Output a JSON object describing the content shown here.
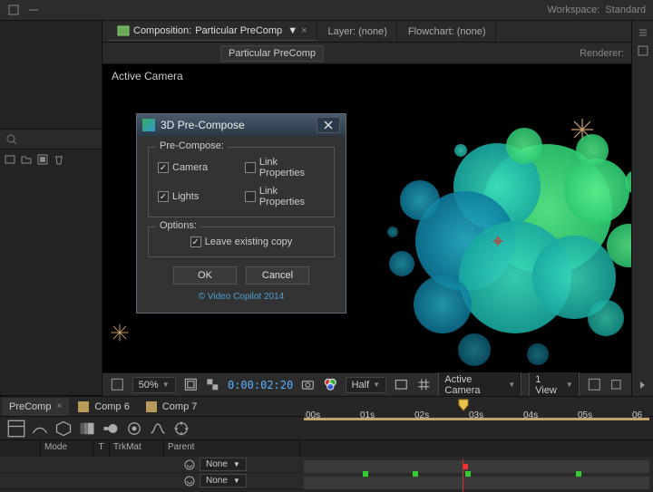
{
  "workspace": {
    "label": "Workspace:",
    "value": "Standard"
  },
  "comp_header": {
    "composition_label": "Composition:",
    "composition_name": "Particular PreComp",
    "layer_tab": "Layer: (none)",
    "flowchart_tab": "Flowchart: (none)",
    "subtab": "Particular PreComp",
    "renderer_label": "Renderer:"
  },
  "viewer": {
    "camera_label": "Active Camera"
  },
  "viewer_bar": {
    "zoom": "50%",
    "timecode": "0:00:02:20",
    "resolution": "Half",
    "camera_dd": "Active Camera",
    "views_dd": "1 View",
    "icons": {
      "bounds": "region-icon",
      "grid": "grid-icon",
      "snapshot": "snapshot-icon",
      "channels": "channels-icon",
      "transparency": "transparency-checker-icon"
    }
  },
  "timeline": {
    "tabs": [
      {
        "label": "PreComp",
        "active": true,
        "close": "×"
      },
      {
        "label": "Comp 6",
        "active": false
      },
      {
        "label": "Comp 7",
        "active": false
      }
    ],
    "ruler": [
      "00s",
      "01s",
      "02s",
      "03s",
      "04s",
      "05s",
      "06"
    ],
    "columns": {
      "mode": "Mode",
      "t": "T",
      "trkmat": "TrkMat",
      "parent": "Parent"
    },
    "none": "None"
  },
  "dialog": {
    "title": "3D Pre-Compose",
    "precompose_label": "Pre-Compose:",
    "options_label": "Options:",
    "camera": "Camera",
    "lights": "Lights",
    "linkprops": "Link Properties",
    "leave": "Leave existing copy",
    "ok": "OK",
    "cancel": "Cancel",
    "copyright": "© Video Copilot 2014"
  }
}
